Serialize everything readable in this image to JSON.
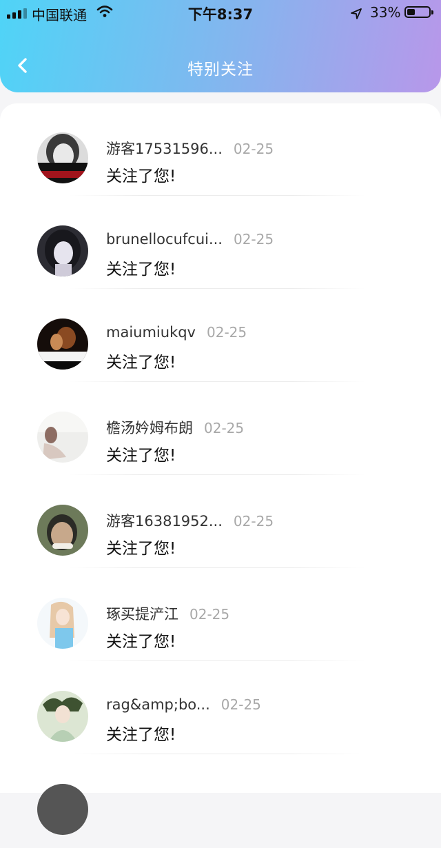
{
  "status_bar": {
    "carrier": "中国联通",
    "time": "下午8:37",
    "battery_percent": "33%",
    "battery_level": 0.33
  },
  "header": {
    "title": "特别关注",
    "back_icon": "chevron-left-icon"
  },
  "colors": {
    "header_gradient_start": "#4fd4f7",
    "header_gradient_end": "#b897ea",
    "date_text": "#a8a8a8"
  },
  "notifications": [
    {
      "username": "游客17531596...",
      "date": "02-25",
      "message": "关注了您!",
      "avatar": "avatar-girl-bw-photo"
    },
    {
      "username": "brunellocufcui...",
      "date": "02-25",
      "message": "关注了您!",
      "avatar": "avatar-anime-girl"
    },
    {
      "username": "maiumiukqv",
      "date": "02-25",
      "message": "关注了您!",
      "avatar": "avatar-candle-photo"
    },
    {
      "username": "檐汤妗姆布朗",
      "date": "02-25",
      "message": "关注了您!",
      "avatar": "avatar-person-sitting"
    },
    {
      "username": "游客16381952...",
      "date": "02-25",
      "message": "关注了您!",
      "avatar": "avatar-man-photo"
    },
    {
      "username": "琢买提浐江",
      "date": "02-25",
      "message": "关注了您!",
      "avatar": "avatar-watercolor-girl"
    },
    {
      "username": "rag&amp;bo...",
      "date": "02-25",
      "message": "关注了您!",
      "avatar": "avatar-ancient-costume"
    }
  ]
}
